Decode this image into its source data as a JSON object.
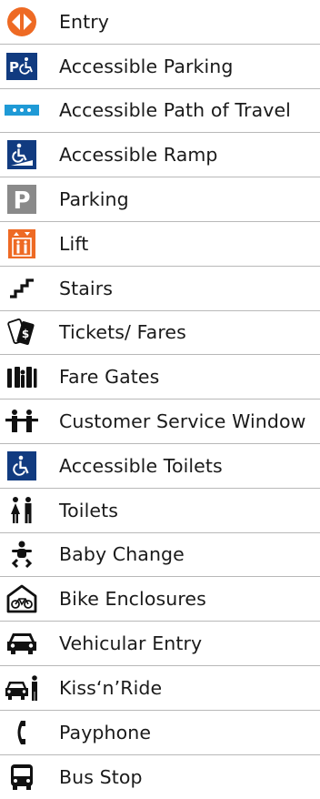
{
  "colors": {
    "navy": "#113b80",
    "orange": "#ee6a24",
    "grey": "#8a8a8a",
    "black": "#111111"
  },
  "legend": {
    "items": [
      {
        "label": "Entry",
        "icon": "entry-icon"
      },
      {
        "label": "Accessible Parking",
        "icon": "accessible-parking-icon"
      },
      {
        "label": "Accessible Path of Travel",
        "icon": "accessible-path-icon"
      },
      {
        "label": "Accessible Ramp",
        "icon": "accessible-ramp-icon"
      },
      {
        "label": "Parking",
        "icon": "parking-icon"
      },
      {
        "label": "Lift",
        "icon": "lift-icon"
      },
      {
        "label": "Stairs",
        "icon": "stairs-icon"
      },
      {
        "label": "Tickets/ Fares",
        "icon": "tickets-icon"
      },
      {
        "label": "Fare Gates",
        "icon": "fare-gates-icon"
      },
      {
        "label": "Customer Service Window",
        "icon": "customer-service-icon"
      },
      {
        "label": "Accessible Toilets",
        "icon": "accessible-toilets-icon"
      },
      {
        "label": "Toilets",
        "icon": "toilets-icon"
      },
      {
        "label": "Baby Change",
        "icon": "baby-change-icon"
      },
      {
        "label": "Bike Enclosures",
        "icon": "bike-enclosure-icon"
      },
      {
        "label": "Vehicular Entry",
        "icon": "car-icon"
      },
      {
        "label": "Kiss‘n’Ride",
        "icon": "kiss-and-ride-icon"
      },
      {
        "label": "Payphone",
        "icon": "payphone-icon"
      },
      {
        "label": "Bus Stop",
        "icon": "bus-icon"
      }
    ]
  }
}
